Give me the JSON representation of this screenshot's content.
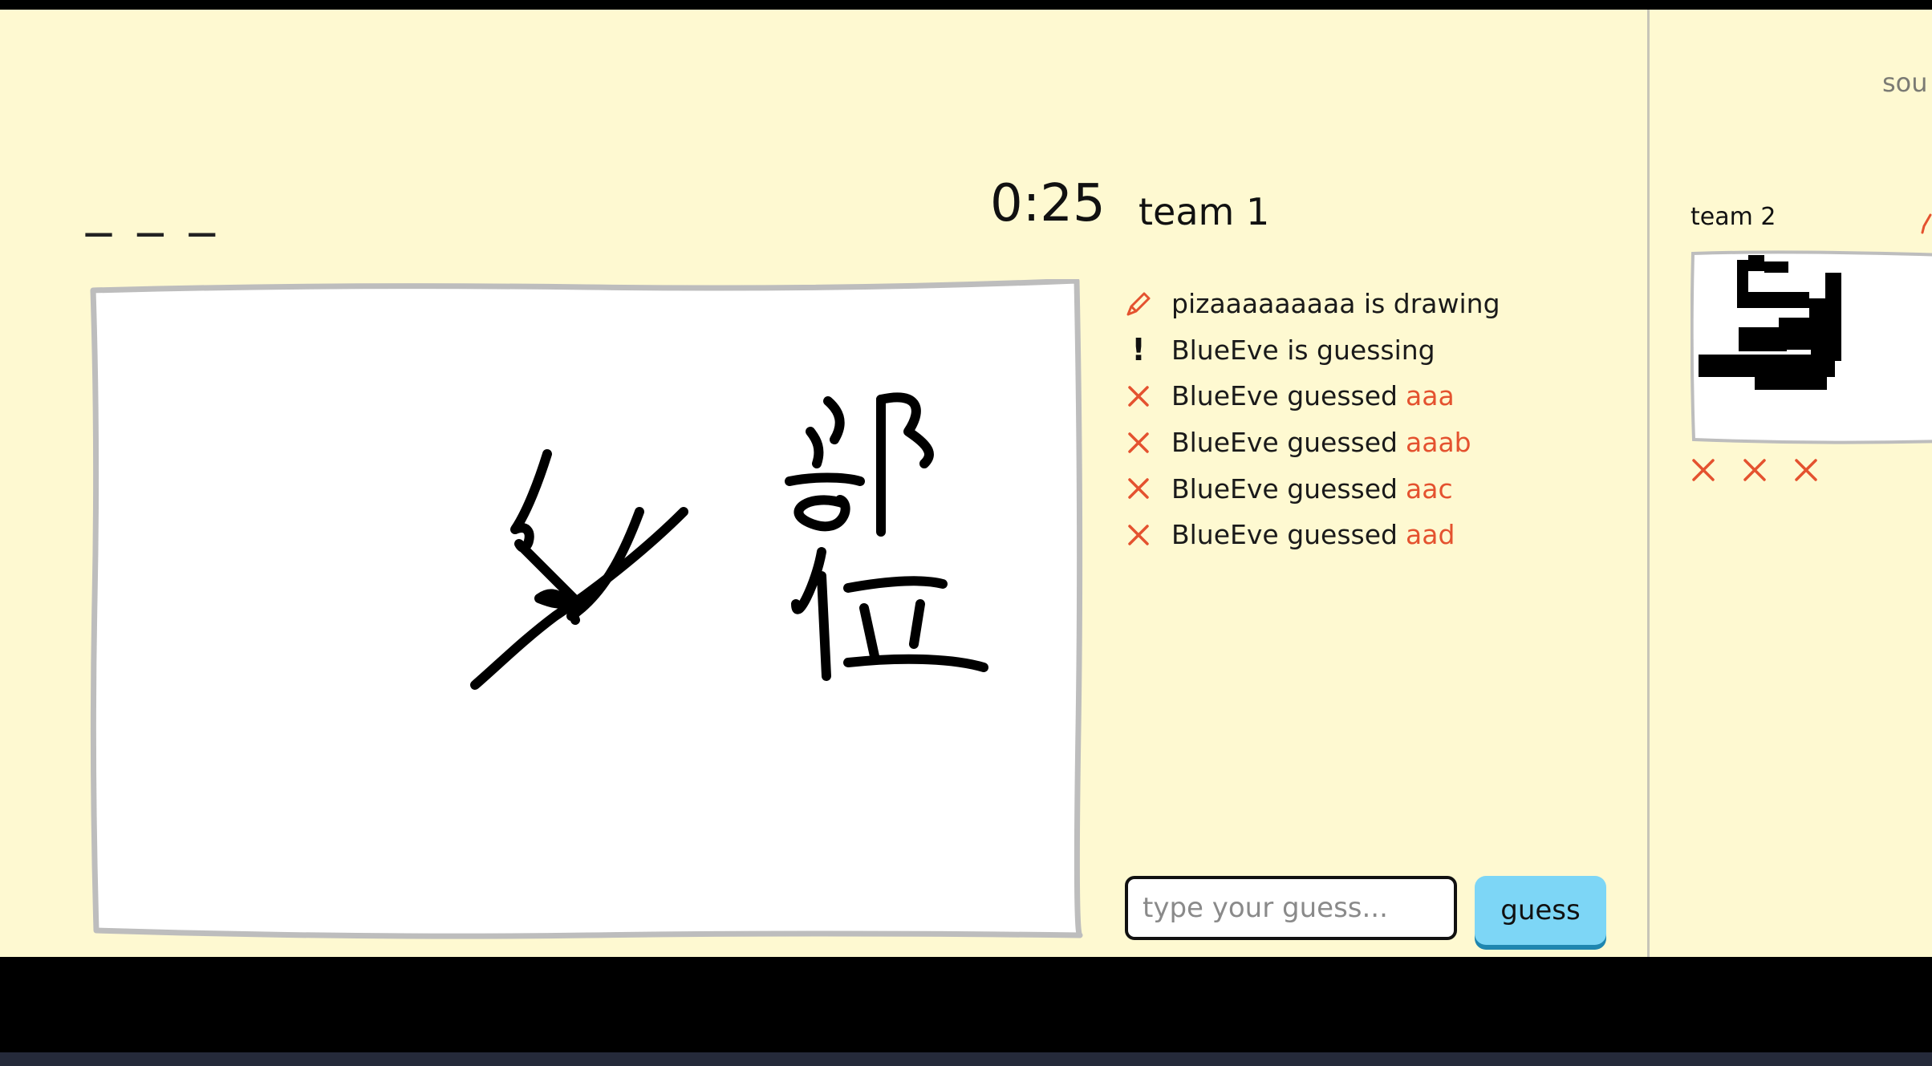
{
  "header": {
    "sound_label": "sou",
    "word_blanks": "_ _ _",
    "timer": "0:25",
    "team_title": "team 1"
  },
  "feed": [
    {
      "icon": "pencil-icon",
      "text": "pizaaaaaaaaa is drawing",
      "guess": ""
    },
    {
      "icon": "exclamation-icon",
      "text": "BlueEve is guessing",
      "guess": ""
    },
    {
      "icon": "x-icon",
      "text": "BlueEve guessed",
      "guess": "aaa"
    },
    {
      "icon": "x-icon",
      "text": "BlueEve guessed",
      "guess": "aaab"
    },
    {
      "icon": "x-icon",
      "text": "BlueEve guessed",
      "guess": "aac"
    },
    {
      "icon": "x-icon",
      "text": "BlueEve guessed",
      "guess": "aad"
    }
  ],
  "guess_form": {
    "placeholder": "type your guess...",
    "button_label": "guess"
  },
  "team2": {
    "label": "team 2",
    "strikes": 3
  },
  "colors": {
    "background": "#fef9d1",
    "accent_red": "#e4522f",
    "button_blue": "#7dd6f6",
    "button_shadow": "#1f86b0",
    "canvas_border": "#bdbdbd"
  }
}
